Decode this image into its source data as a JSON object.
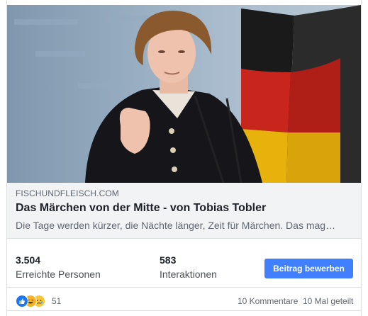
{
  "link": {
    "domain": "FISCHUNDFLEISCH.COM",
    "title": "Das Märchen von der Mitte - von Tobias Tobler",
    "description": "Die Tage werden kürzer, die Nächte länger, Zeit für Märchen. Das mag…"
  },
  "stats": {
    "reach_value": "3.504",
    "reach_label": "Erreichte Personen",
    "interactions_value": "583",
    "interactions_label": "Interaktionen",
    "boost_label": "Beitrag bewerben"
  },
  "footer": {
    "reaction_icons": [
      "like-icon",
      "haha-icon",
      "sad-icon"
    ],
    "reaction_count": "51",
    "comments": "10 Kommentare",
    "shares": "10 Mal geteilt"
  },
  "colors": {
    "accent": "#4080ff",
    "like": "#1877f2",
    "haha": "#f7b125"
  }
}
